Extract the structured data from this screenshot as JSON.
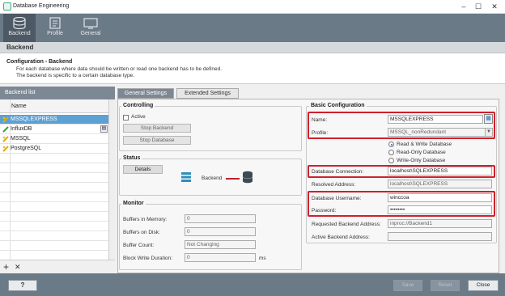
{
  "window": {
    "title": "Database Engineering"
  },
  "toolbar": {
    "items": [
      {
        "label": "Backend"
      },
      {
        "label": "Profile"
      },
      {
        "label": "General"
      }
    ]
  },
  "section_header": "Backend",
  "description": {
    "title": "Configuration - Backend",
    "lines": [
      "For each database where data should be written or read one backend has to be defined.",
      "The backend is specific to a certain database type."
    ]
  },
  "backend_list": {
    "title": "Backend list",
    "column_header": "Name",
    "items": [
      {
        "name": "MSSQLEXPRESS",
        "selected": true
      },
      {
        "name": "InfluxDB",
        "selected": false
      },
      {
        "name": "MSSQL",
        "selected": false
      },
      {
        "name": "PostgreSQL",
        "selected": false
      }
    ],
    "add_icon": "+",
    "delete_icon": "✕"
  },
  "tabs": [
    {
      "label": "General Settings",
      "active": true
    },
    {
      "label": "Extended Settings",
      "active": false
    }
  ],
  "controlling": {
    "title": "Controlling",
    "active_label": "Active",
    "active_checked": false,
    "stop_backend": "Stop Backend",
    "stop_database": "Stop Database"
  },
  "status": {
    "title": "Status",
    "details": "Details",
    "backend_label": "Backend"
  },
  "monitor": {
    "title": "Monitor",
    "buffers_memory_label": "Buffers in Memory:",
    "buffers_memory_value": "0",
    "buffers_disk_label": "Buffers on Disk:",
    "buffers_disk_value": "0",
    "buffer_count_label": "Buffer Count:",
    "buffer_count_value": "Not Changing",
    "block_write_label": "Block Write Duration:",
    "block_write_value": "0",
    "block_write_unit": "ms"
  },
  "basic": {
    "title": "Basic Configuration",
    "name_label": "Name:",
    "name_value": "MSSQLEXPRESS",
    "profile_label": "Profile:",
    "profile_value": "MSSQL_nonRedundant",
    "radio_rw": "Read & Write Database",
    "radio_ro": "Read-Only Database",
    "radio_wo": "Write-Only Database",
    "radio_selected": "rw",
    "conn_label": "Database Connection:",
    "conn_value": "localhost\\SQLEXPRESS",
    "resolved_label": "Resolved Address:",
    "resolved_value": "localhost\\SQLEXPRESS",
    "user_label": "Database Username:",
    "user_value": "winccoa",
    "pw_label": "Password:",
    "pw_value": "••••••••",
    "requested_label": "Requested Backend Address:",
    "requested_value": "inproc://Backend1",
    "active_addr_label": "Active Backend Address:",
    "active_addr_value": ""
  },
  "footer": {
    "help": "?",
    "save": "Save",
    "reset": "Reset",
    "close": "Close"
  },
  "colors": {
    "toolbar": "#6b7a87",
    "selection": "#5da0d4",
    "highlight": "#d0202c"
  }
}
